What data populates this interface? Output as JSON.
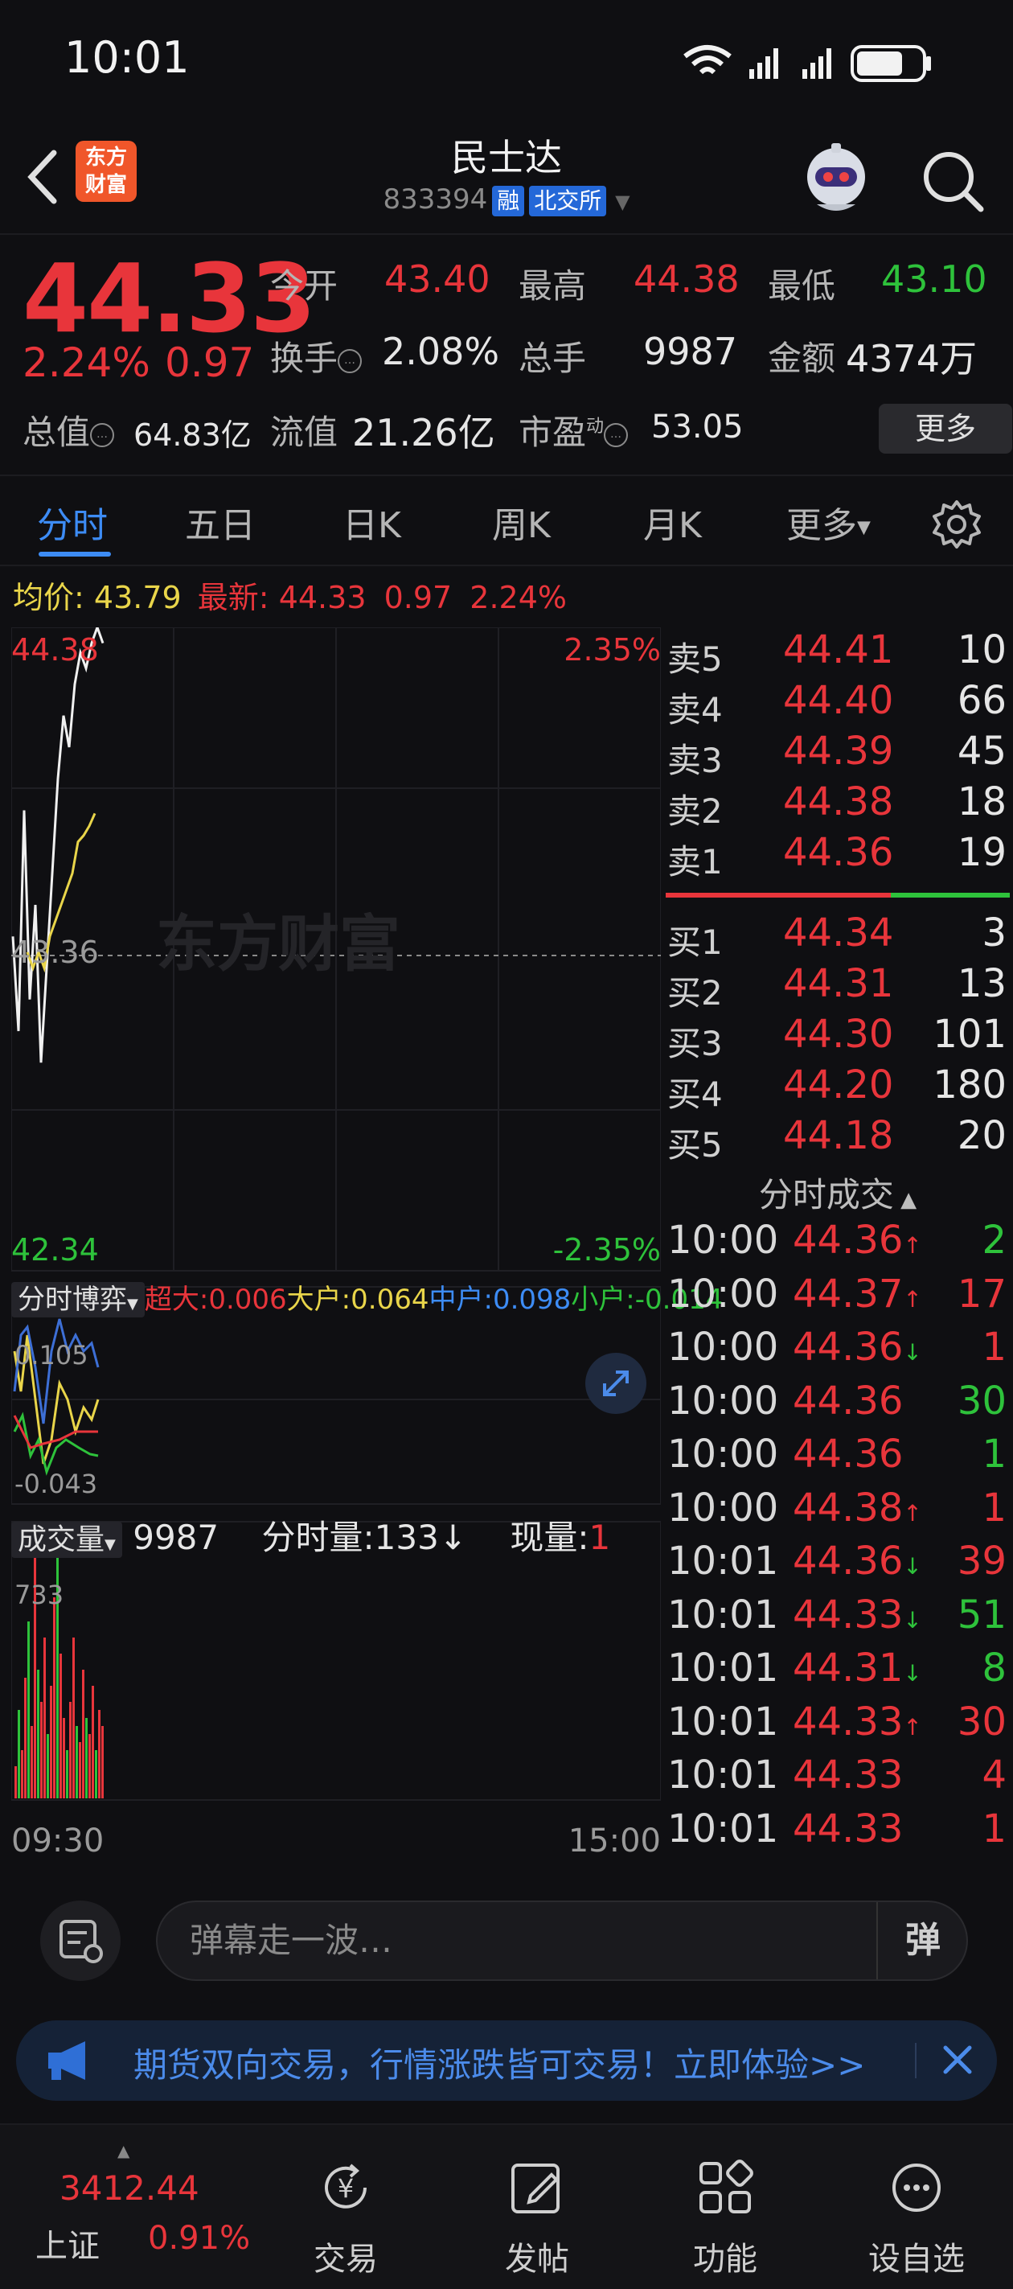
{
  "status_bar": {
    "time": "10:01"
  },
  "header": {
    "stock_name": "民士达",
    "stock_code": "833394",
    "tag_margin": "融",
    "tag_exchange": "北交所",
    "logo_text_top": "东方",
    "logo_text_bottom": "财富"
  },
  "quote": {
    "last_price": "44.33",
    "change_pct": "2.24%",
    "change_abs": "0.97",
    "open_label": "今开",
    "open": "43.40",
    "high_label": "最高",
    "high": "44.38",
    "low_label": "最低",
    "low": "43.10",
    "turnover_label": "换手",
    "turnover": "2.08%",
    "volume_label": "总手",
    "volume": "9987",
    "amount_label": "金额",
    "amount": "4374万",
    "mktcap_label": "总值",
    "mktcap": "64.83亿",
    "float_label": "流值",
    "float_cap": "21.26亿",
    "pe_label": "市盈",
    "pe_sup": "动",
    "pe": "53.05",
    "more_label": "更多"
  },
  "tabs": [
    "分时",
    "五日",
    "日K",
    "周K",
    "月K",
    "更多"
  ],
  "price_summary": {
    "avg_label": "均价:",
    "avg": "43.79",
    "latest_label": "最新:",
    "latest": "44.33",
    "latest_chg": "0.97",
    "latest_pct": "2.24%"
  },
  "intraday_chart": {
    "price_top": "44.38",
    "pct_top": "2.35%",
    "price_mid": "43.36",
    "price_bottom": "42.34",
    "pct_bottom": "-2.35%",
    "watermark": "东方财富",
    "time_start": "09:30",
    "time_end": "15:00"
  },
  "chart_data": {
    "type": "line",
    "ylim": [
      42.34,
      44.38
    ],
    "series": [
      {
        "values": [
          43.4,
          43.1,
          43.8,
          43.2,
          43.5,
          43.0,
          43.3,
          43.6,
          43.9,
          44.1,
          44.0,
          44.2,
          44.3,
          44.25,
          44.33,
          44.38,
          44.33
        ]
      },
      {
        "values": [
          43.35,
          43.3,
          43.35,
          43.3,
          43.4,
          43.45,
          43.5,
          43.55,
          43.6,
          43.7,
          43.72,
          43.75,
          43.79
        ]
      }
    ]
  },
  "fund_flow": {
    "selector": "分时博弈",
    "super_label": "超大:",
    "super": "0.006",
    "large_label": "大户:",
    "large": "0.064",
    "mid_label": "中户:",
    "mid": "0.098",
    "small_label": "小户:",
    "small": "-0.014",
    "y_top": "0.105",
    "y_bottom": "-0.043"
  },
  "volume_panel": {
    "selector": "成交量",
    "total": "9987",
    "minute_label": "分时量:",
    "minute": "133↓",
    "now_label": "现量:",
    "now": "1",
    "y_top": "733"
  },
  "order_book": {
    "asks": [
      {
        "label": "卖5",
        "price": "44.41",
        "vol": "10"
      },
      {
        "label": "卖4",
        "price": "44.40",
        "vol": "66"
      },
      {
        "label": "卖3",
        "price": "44.39",
        "vol": "45"
      },
      {
        "label": "卖2",
        "price": "44.38",
        "vol": "18"
      },
      {
        "label": "卖1",
        "price": "44.36",
        "vol": "19"
      }
    ],
    "bids": [
      {
        "label": "买1",
        "price": "44.34",
        "vol": "3"
      },
      {
        "label": "买2",
        "price": "44.31",
        "vol": "13"
      },
      {
        "label": "买3",
        "price": "44.30",
        "vol": "101"
      },
      {
        "label": "买4",
        "price": "44.20",
        "vol": "180"
      },
      {
        "label": "买5",
        "price": "44.18",
        "vol": "20"
      }
    ]
  },
  "trades": {
    "title": "分时成交",
    "rows": [
      {
        "time": "10:00",
        "price": "44.36",
        "dir": "↑",
        "vol": "2",
        "vcolor": "green"
      },
      {
        "time": "10:00",
        "price": "44.37",
        "dir": "↑",
        "vol": "17",
        "vcolor": "red"
      },
      {
        "time": "10:00",
        "price": "44.36",
        "dir": "↓",
        "vol": "1",
        "vcolor": "red"
      },
      {
        "time": "10:00",
        "price": "44.36",
        "dir": "",
        "vol": "30",
        "vcolor": "green"
      },
      {
        "time": "10:00",
        "price": "44.36",
        "dir": "",
        "vol": "1",
        "vcolor": "green"
      },
      {
        "time": "10:00",
        "price": "44.38",
        "dir": "↑",
        "vol": "1",
        "vcolor": "red"
      },
      {
        "time": "10:01",
        "price": "44.36",
        "dir": "↓",
        "vol": "39",
        "vcolor": "red"
      },
      {
        "time": "10:01",
        "price": "44.33",
        "dir": "↓",
        "vol": "51",
        "vcolor": "green"
      },
      {
        "time": "10:01",
        "price": "44.31",
        "dir": "↓",
        "vol": "8",
        "vcolor": "green"
      },
      {
        "time": "10:01",
        "price": "44.33",
        "dir": "↑",
        "vol": "30",
        "vcolor": "red"
      },
      {
        "time": "10:01",
        "price": "44.33",
        "dir": "",
        "vol": "4",
        "vcolor": "red"
      },
      {
        "time": "10:01",
        "price": "44.33",
        "dir": "",
        "vol": "1",
        "vcolor": "red"
      }
    ]
  },
  "danmaku": {
    "placeholder": "弹幕走一波…",
    "send": "弹"
  },
  "promo": {
    "text": "期货双向交易，行情涨跌皆可交易！立即体验>>"
  },
  "bottom_nav": {
    "index_value": "3412.44",
    "index_name": "上证",
    "index_pct": "0.91%",
    "items": [
      "交易",
      "发帖",
      "功能",
      "设自选"
    ]
  }
}
